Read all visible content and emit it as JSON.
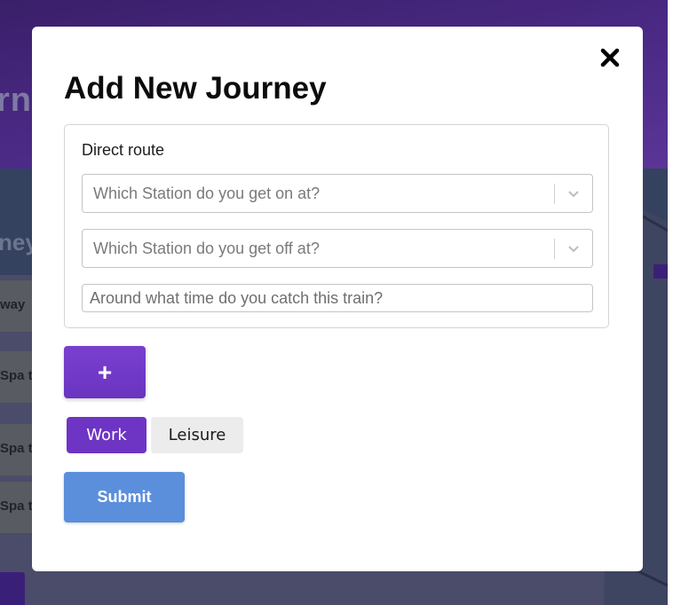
{
  "background": {
    "header_title": "rne",
    "subheading": "ney",
    "cards": [
      "way",
      "Spa t",
      "Spa t",
      "Spa t"
    ]
  },
  "modal": {
    "title": "Add New Journey",
    "close_icon": "close-icon",
    "route": {
      "label": "Direct route",
      "board_station": {
        "placeholder": "Which Station do you get on at?"
      },
      "alight_station": {
        "placeholder": "Which Station do you get off at?"
      },
      "time": {
        "placeholder": "Around what time do you catch this train?",
        "value": ""
      }
    },
    "add_button": "+",
    "journey_type": {
      "options": [
        "Work",
        "Leisure"
      ],
      "selected": "Work"
    },
    "submit_label": "Submit"
  },
  "colors": {
    "accent_purple": "#6e34c4",
    "submit_blue": "#5b8fdc",
    "overlay_header": "#4b2a86"
  }
}
